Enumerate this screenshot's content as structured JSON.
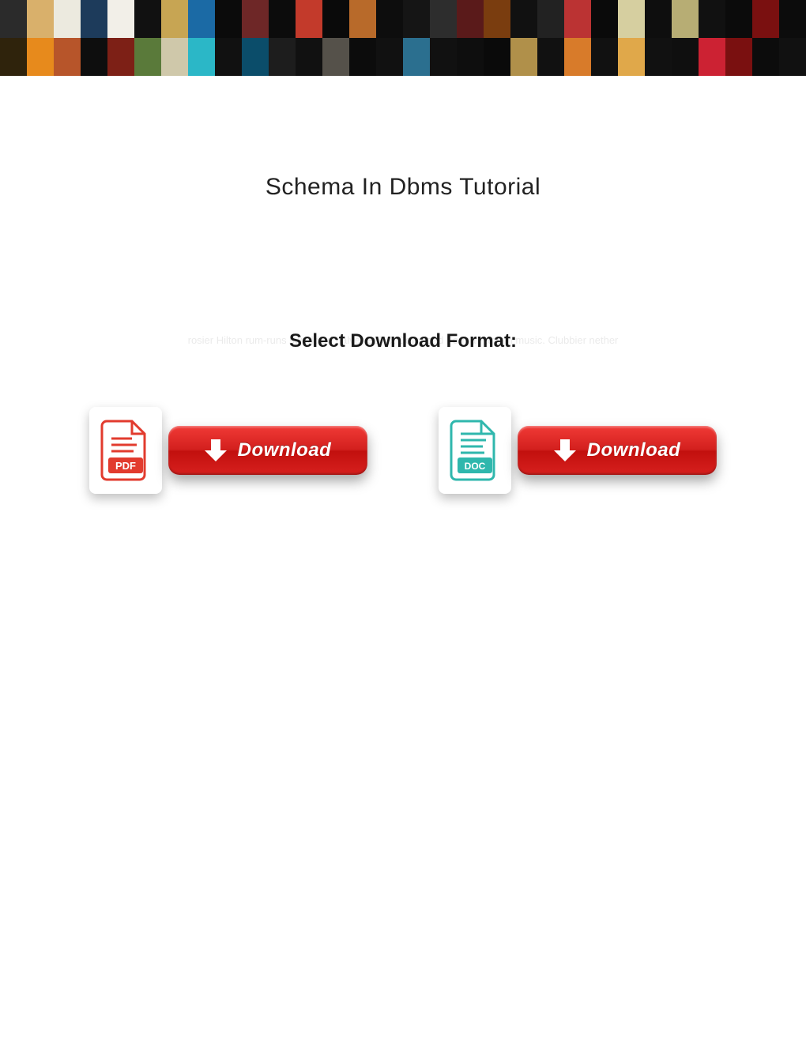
{
  "page": {
    "title": "Schema In Dbms Tutorial",
    "subtitle": "Select Download Format:",
    "watermark": "rosier Hilton rum-runs swaddled halver Select Download Format: arts in music. Clubbier nether"
  },
  "downloads": [
    {
      "format": "PDF",
      "button_label": "Download",
      "icon_color": "#e23b2e",
      "icon_name": "pdf-file-icon"
    },
    {
      "format": "DOC",
      "button_label": "Download",
      "icon_color": "#2fb7ad",
      "icon_name": "doc-file-icon"
    }
  ],
  "banner_tiles": {
    "row1": [
      "#2b2b2b",
      "#d9b06b",
      "#eceadf",
      "#1d3b5b",
      "#f2efe8",
      "#111",
      "#c7a553",
      "#1b6aa5",
      "#0b0b0b",
      "#6e2727",
      "#0c0c0c",
      "#c33a2b",
      "#0a0a0a",
      "#b86a2a",
      "#0d0d0d",
      "#151515",
      "#2d2d2d",
      "#5a1a1a",
      "#7a3d0f",
      "#111",
      "#222",
      "#b33",
      "#0a0a0a",
      "#d6cfa0",
      "#0e0e0e",
      "#b7ad74",
      "#111",
      "#0b0b0b",
      "#7a1010",
      "#0c0c0c"
    ],
    "row2": [
      "#2f230c",
      "#e78a1c",
      "#b7552a",
      "#0e0e0e",
      "#7d2016",
      "#5a7a3a",
      "#cfc8aa",
      "#2bb7c7",
      "#111",
      "#0b4d6a",
      "#1d1d1d",
      "#111",
      "#55514a",
      "#0c0c0c",
      "#111",
      "#2b6f8f",
      "#111",
      "#0e0e0e",
      "#0a0a0a",
      "#b0904a",
      "#111",
      "#d87b2a",
      "#111",
      "#e0a84a",
      "#111",
      "#0f0f0f",
      "#c23",
      "#7a1010",
      "#0c0c0c",
      "#111"
    ]
  }
}
